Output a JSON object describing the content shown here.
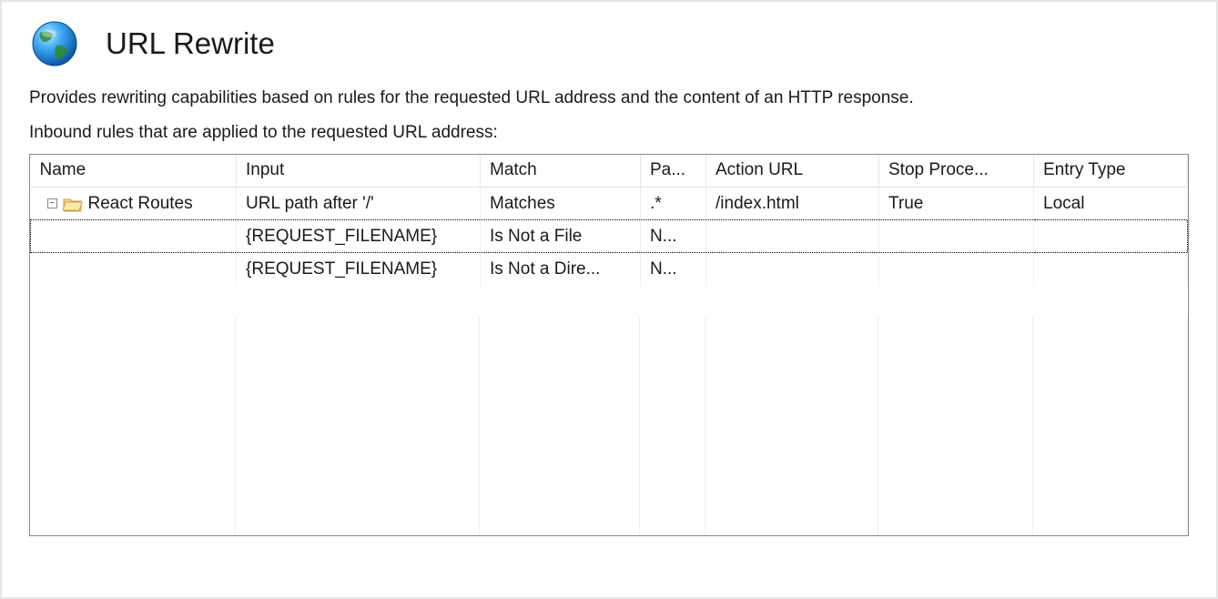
{
  "header": {
    "title": "URL Rewrite",
    "description": "Provides rewriting capabilities based on rules for the requested URL address and the content of an HTTP response.",
    "subheading": "Inbound rules that are applied to the requested URL address:"
  },
  "columns": {
    "name": "Name",
    "input": "Input",
    "match": "Match",
    "pattern": "Pa...",
    "action_url": "Action URL",
    "stop": "Stop Proce...",
    "entry_type": "Entry Type"
  },
  "rows": [
    {
      "name": "React Routes",
      "input": "URL path after '/'",
      "match": "Matches",
      "pattern": ".*",
      "action_url": "/index.html",
      "stop": "True",
      "entry_type": "Local",
      "is_parent": true,
      "selected": false
    },
    {
      "name": "",
      "input": "{REQUEST_FILENAME}",
      "match": "Is Not a File",
      "pattern": "N...",
      "action_url": "",
      "stop": "",
      "entry_type": "",
      "is_parent": false,
      "selected": true
    },
    {
      "name": "",
      "input": "{REQUEST_FILENAME}",
      "match": "Is Not a Dire...",
      "pattern": "N...",
      "action_url": "",
      "stop": "",
      "entry_type": "",
      "is_parent": false,
      "selected": false
    }
  ],
  "icons": {
    "tree_toggle_glyph": "−"
  }
}
